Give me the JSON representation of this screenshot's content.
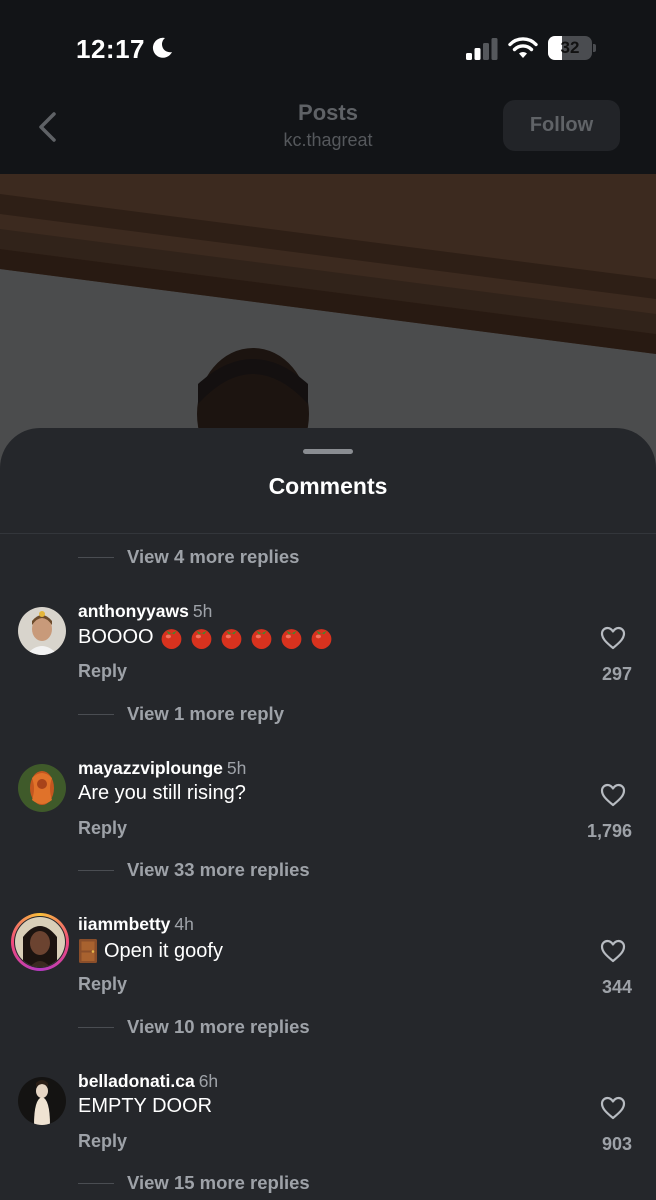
{
  "status_bar": {
    "time": "12:17",
    "battery": "32",
    "battery_level": 0.32
  },
  "header": {
    "title": "Posts",
    "subtitle": "kc.thagreat",
    "follow_label": "Follow"
  },
  "sheet": {
    "title": "Comments",
    "top_view_more": "View 4 more replies"
  },
  "comments": [
    {
      "username": "anthonyyaws",
      "time": "5h",
      "text": "BOOOO",
      "emoji": "tomato x6",
      "reply_label": "Reply",
      "likes": "297",
      "view_more": "View 1 more reply"
    },
    {
      "username": "mayazzviplounge",
      "time": "5h",
      "text": "Are you still rising?",
      "reply_label": "Reply",
      "likes": "1,796",
      "view_more": "View 33 more replies"
    },
    {
      "username": "iiammbetty",
      "time": "4h",
      "text": "Open it goofy",
      "emoji": "door",
      "reply_label": "Reply",
      "likes": "344",
      "view_more": "View 10 more replies"
    },
    {
      "username": "belladonati.ca",
      "time": "6h",
      "text": "EMPTY DOOR",
      "reply_label": "Reply",
      "likes": "903",
      "view_more": "View 15 more replies"
    }
  ],
  "icons": [
    "moon-icon",
    "signal-icon",
    "wifi-icon",
    "battery-icon",
    "back-chevron-icon",
    "heart-icon",
    "tomato-emoji",
    "door-emoji"
  ],
  "colors": {
    "sheet_bg": "#25272b",
    "header_bg": "#121417",
    "muted_text": "#9ea2a8"
  }
}
